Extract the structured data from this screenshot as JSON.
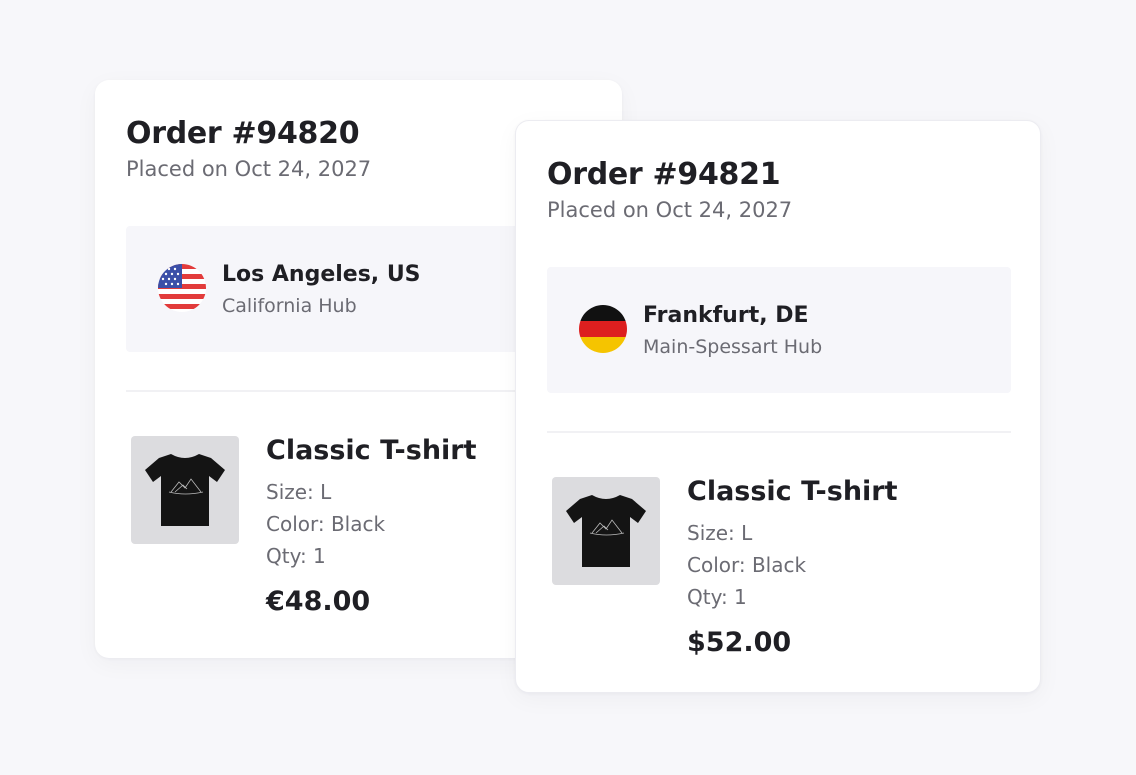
{
  "orders": [
    {
      "title": "Order #94820",
      "placed": "Placed on Oct 24, 2027",
      "hub": {
        "city": "Los Angeles, US",
        "name": "California Hub",
        "flag": "us-flag-icon"
      },
      "product": {
        "name": "Classic T-shirt",
        "size": "Size: L",
        "color": "Color: Black",
        "qty": "Qty: 1",
        "price": "€48.00",
        "image": "black-tshirt-mountain-print"
      }
    },
    {
      "title": "Order #94821",
      "placed": "Placed on Oct 24, 2027",
      "hub": {
        "city": "Frankfurt, DE",
        "name": "Main-Spessart Hub",
        "flag": "de-flag-icon"
      },
      "product": {
        "name": "Classic T-shirt",
        "size": "Size: L",
        "color": "Color: Black",
        "qty": "Qty: 1",
        "price": "$52.00",
        "image": "black-tshirt-mountain-print"
      }
    }
  ],
  "colors": {
    "background": "#f7f7fa",
    "card": "#ffffff",
    "hub_box": "#f6f6fa",
    "text_primary": "#1f1f24",
    "text_secondary": "#6b6b73",
    "thumb_bg": "#dcdcdf"
  }
}
